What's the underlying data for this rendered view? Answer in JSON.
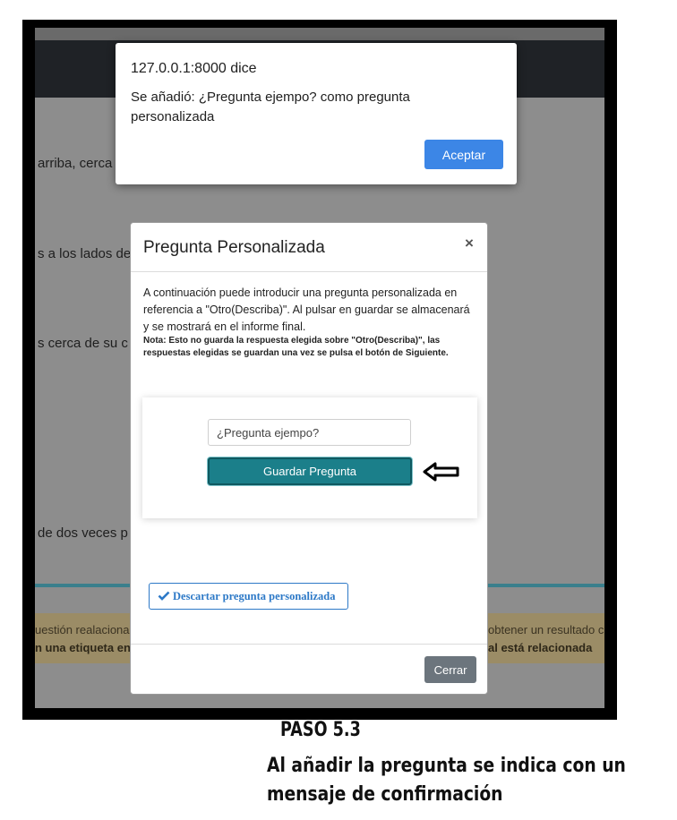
{
  "background_page": {
    "lines": [
      "arriba, cerca",
      "s a los lados de",
      "s cerca de su c",
      "de dos veces p"
    ],
    "warning": {
      "left_line1": "uestión realacionad",
      "left_line2": "n una etiqueta en",
      "right_line1": "obtener un resultado c",
      "right_line2": "al está relacionada"
    }
  },
  "alert": {
    "title": "127.0.0.1:8000 dice",
    "message": "Se añadió: ¿Pregunta ejempo? como pregunta personalizada",
    "accept_label": "Aceptar",
    "accent_color": "#3c86e6"
  },
  "modal": {
    "title": "Pregunta Personalizada",
    "close_symbol": "×",
    "description": "A continuación puede introducir una pregunta personalizada en referencia a \"Otro(Describa)\". Al pulsar en guardar se almacenará y se mostrará en el informe final.",
    "note": "Nota: Esto no guarda la respuesta elegida sobre \"Otro(Describa)\", las respuestas elegidas se guardan una vez se pulsa el botón de Siguiente.",
    "question_value": "¿Pregunta ejempo?",
    "save_label": "Guardar Pregunta",
    "save_color": "#1b7f8a",
    "discard_label": "Descartar pregunta personalizada",
    "discard_icon": "check-icon",
    "close_label": "Cerrar"
  },
  "caption": {
    "step": "PASO 5.3",
    "line1": "Al añadir la pregunta se indica con un",
    "line2": "mensaje de confirmación"
  }
}
